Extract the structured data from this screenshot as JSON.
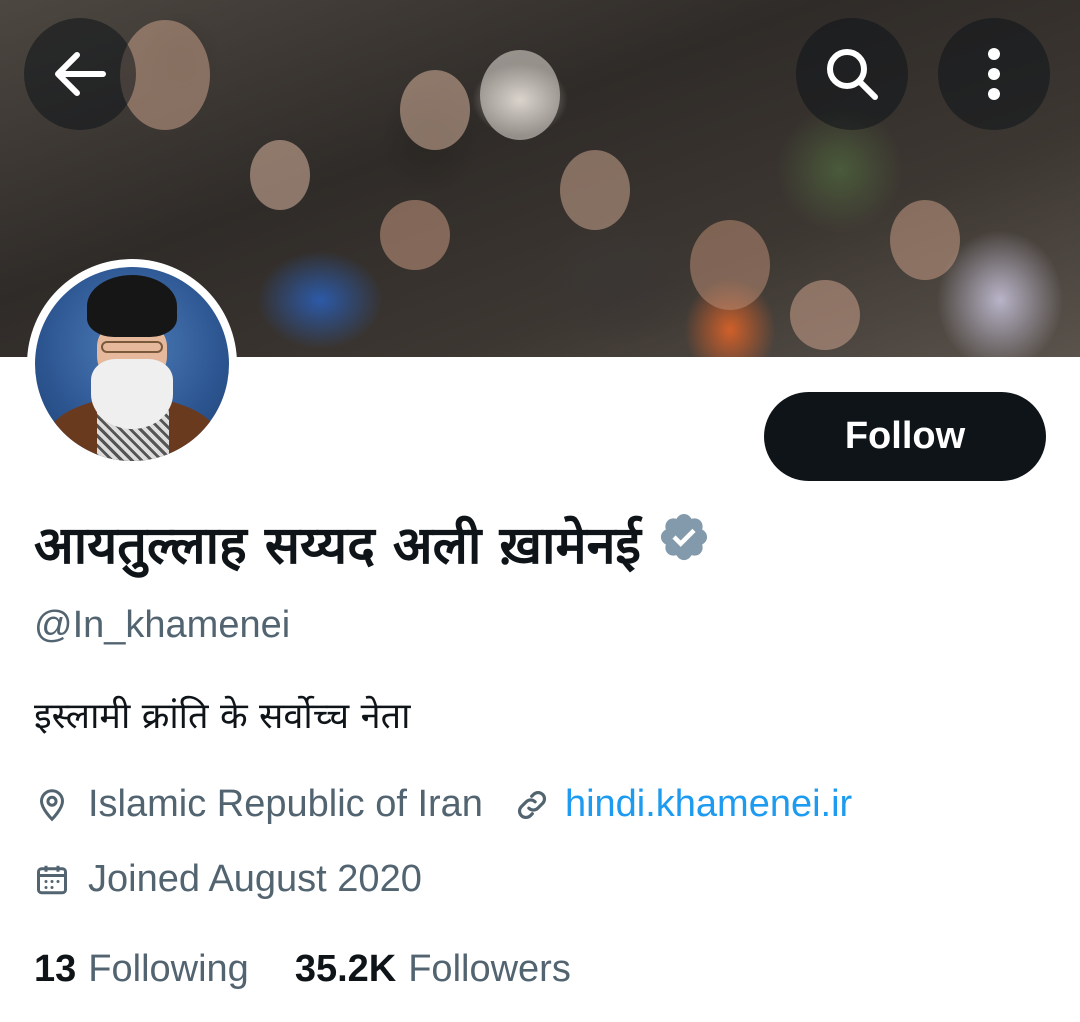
{
  "header": {
    "back_icon": "arrow-left-icon",
    "search_icon": "search-icon",
    "more_icon": "more-vertical-icon"
  },
  "profile": {
    "display_name": "आयतुल्लाह सय्यद अली ख़ामेनई",
    "verified_icon": "verified-badge-icon",
    "handle": "@In_khamenei",
    "bio": "इस्लामी क्रांति के सर्वोच्च नेता",
    "location": "Islamic Republic of Iran",
    "website": "hindi.khamenei.ir",
    "joined": "Joined August 2020"
  },
  "actions": {
    "follow_label": "Follow"
  },
  "stats": {
    "following_count": "13",
    "following_label": "Following",
    "followers_count": "35.2K",
    "followers_label": "Followers"
  },
  "colors": {
    "primary_text": "#0f1419",
    "secondary_text": "#536471",
    "link": "#1d9bf0",
    "button_bg": "#0f1419"
  }
}
